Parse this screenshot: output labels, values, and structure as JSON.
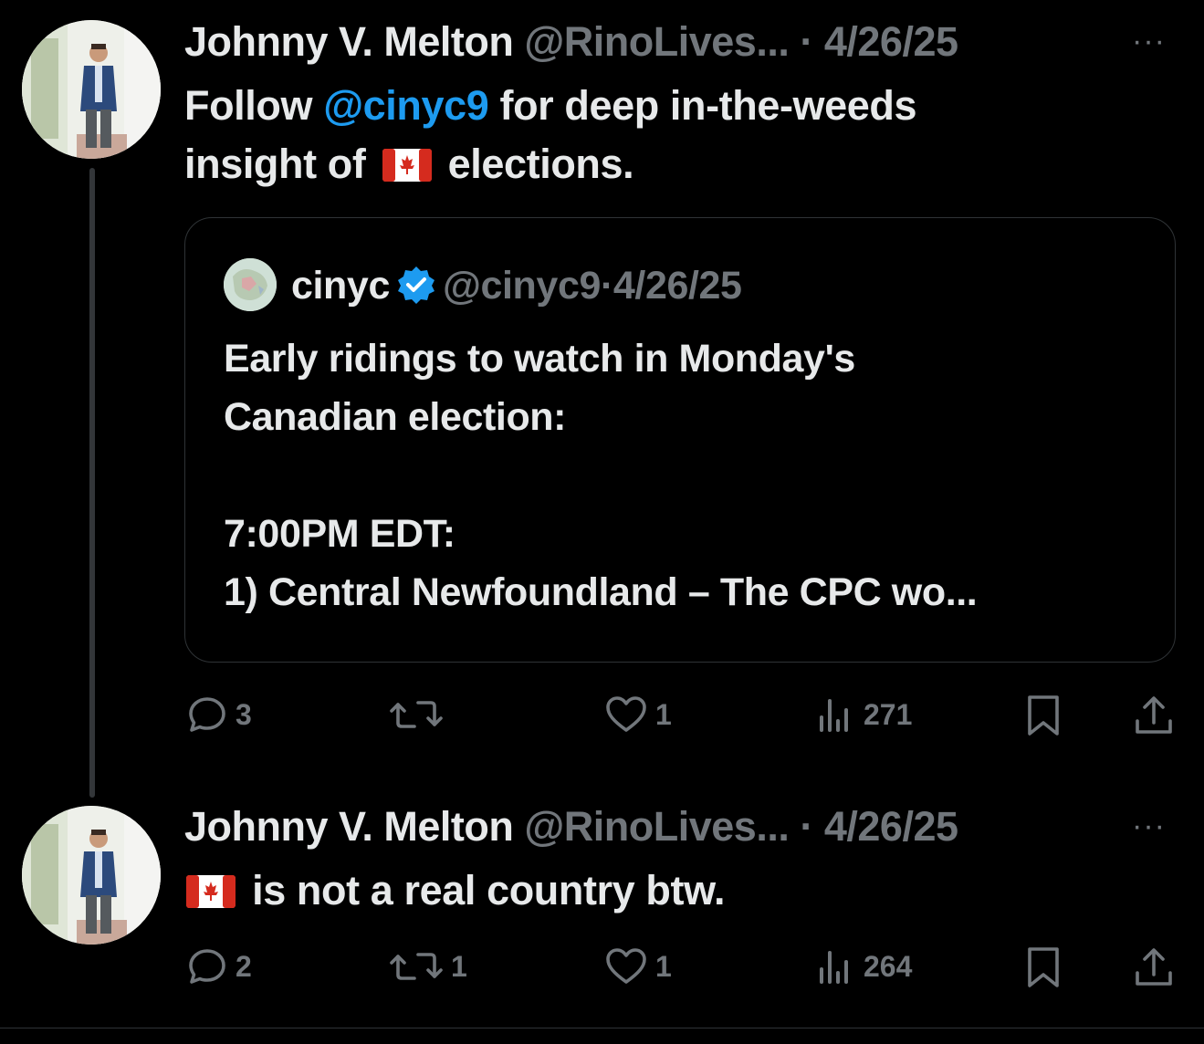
{
  "thread": [
    {
      "author_name": "Johnny V. Melton",
      "handle": "@RinoLives...",
      "separator": "·",
      "date": "4/26/25",
      "more_label": "···",
      "text_before_mention": "Follow ",
      "mention": "@cinyc9",
      "text_after_mention": " for deep in-the-weeds",
      "text_line2_before_flag": "insight of ",
      "flag_icon": "canada-flag-icon",
      "text_line2_after_flag": " elections.",
      "quote": {
        "author_name": "cinyc",
        "handle": "@cinyc9",
        "separator": "·",
        "date": "4/26/25",
        "lines": [
          "Early ridings to watch in Monday's",
          "Canadian election:",
          "",
          "7:00PM EDT:",
          "1) Central Newfoundland – The CPC wo..."
        ]
      },
      "actions": {
        "replies": "3",
        "reposts": "",
        "likes": "1",
        "views": "271"
      }
    },
    {
      "author_name": "Johnny V. Melton",
      "handle": "@RinoLives...",
      "separator": "·",
      "date": "4/26/25",
      "more_label": "···",
      "flag_icon": "canada-flag-icon",
      "text": " is not a real country btw.",
      "actions": {
        "replies": "2",
        "reposts": "1",
        "likes": "1",
        "views": "264"
      }
    }
  ],
  "colors": {
    "background": "#000000",
    "text": "#e7e9ea",
    "muted": "#71767b",
    "accent": "#1d9bf0",
    "border": "#2f3336"
  }
}
